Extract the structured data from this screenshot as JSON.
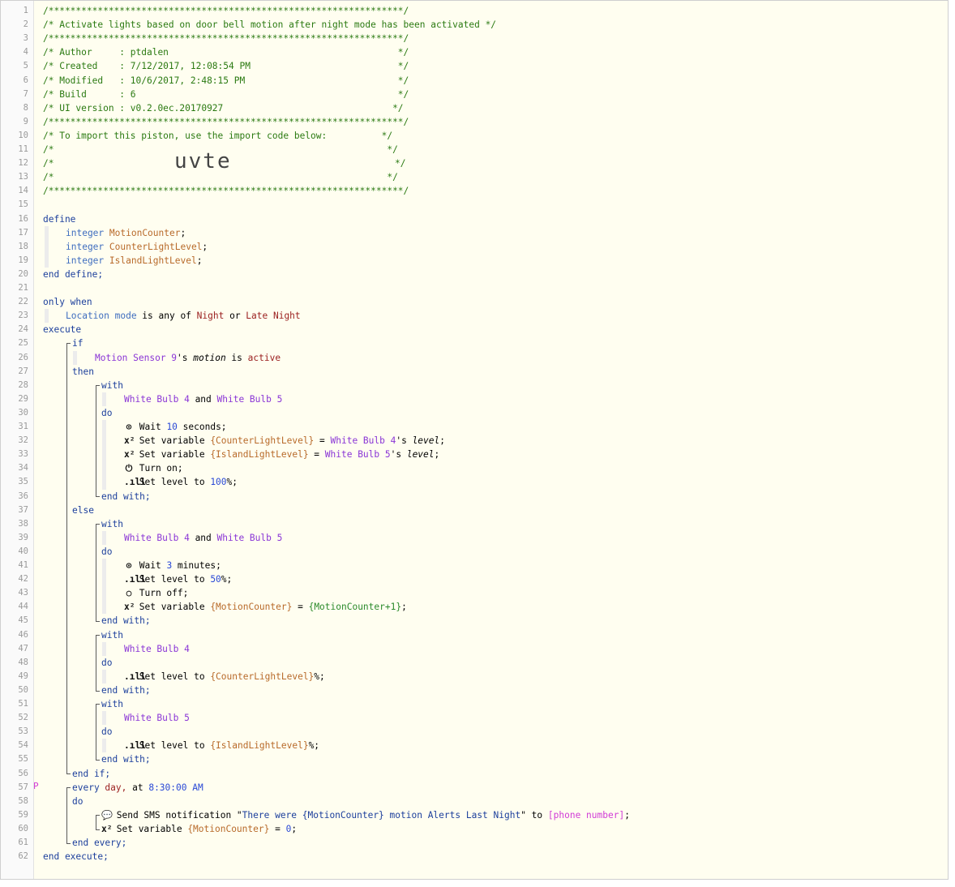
{
  "header": {
    "border": "/*****************************************************************/",
    "title": "/* Activate lights based on door bell motion after night mode has been activated */",
    "author": "/* Author     : ptdalen                                          */",
    "created": "/* Created    : 7/12/2017, 12:08:54 PM                           */",
    "modified": "/* Modified   : 10/6/2017, 2:48:15 PM                            */",
    "build": "/* Build      : 6                                                */",
    "ui_version": "/* UI version : v0.2.0ec.20170927                               */",
    "import_text": "/* To import this piston, use the import code below:          */",
    "blank_comment": "/*                                                             */",
    "import_code": "uvte"
  },
  "lines": {
    "l12_prefix": "/*",
    "l12_suffix": "*/",
    "define": "define",
    "integer": "integer",
    "v1": "MotionCounter",
    "v2": "CounterLightLevel",
    "v3": "IslandLightLevel",
    "semi": ";",
    "end_define": "end define;",
    "only_when": "only when",
    "loc_mode": "Location mode",
    "is_any_of": " is any of ",
    "night": "Night",
    "or": " or ",
    "late_night": "Late Night",
    "execute": "execute",
    "if": "if",
    "motion_sensor": "Motion Sensor 9",
    "possessive": "'s ",
    "motion": "motion",
    "is": " is ",
    "active": "active",
    "then": "then",
    "with": "with",
    "wb4": "White Bulb 4",
    "and": " and ",
    "wb5": "White Bulb 5",
    "do": "do",
    "wait": "Wait ",
    "ten": "10",
    "seconds": " seconds;",
    "set_variable": "Set variable ",
    "counter_brace": "{CounterLightLevel}",
    "eq": " = ",
    "level": "level",
    "island_brace": "{IslandLightLevel}",
    "turn_on": "Turn on;",
    "set_level_to": "Set level to ",
    "hundred": "100",
    "pct_semi": "%;",
    "end_with": "end with;",
    "else": "else",
    "three": "3",
    "minutes": " minutes;",
    "fifty": "50",
    "turn_off": "Turn off;",
    "mc_brace": "{MotionCounter}",
    "mc_plus": "{MotionCounter+1}",
    "end_if": "end if;",
    "every": "every ",
    "day": "day,",
    "at": " at ",
    "time": "8:30:00 AM",
    "send_sms": "Send SMS notification \"",
    "msg1": "There were ",
    "msg_var": "{MotionCounter}",
    "msg2": " motion Alerts Last Night",
    "to": "\" to ",
    "phone": "[phone number]",
    "zero": "0",
    "end_every": "end every;",
    "end_execute": "end execute;",
    "p_marker": "P"
  },
  "icons": {
    "clock": "⊙",
    "x2": "x²",
    "power": "⏻",
    "level": ".ıll",
    "circle": "○",
    "chat": "💬"
  }
}
